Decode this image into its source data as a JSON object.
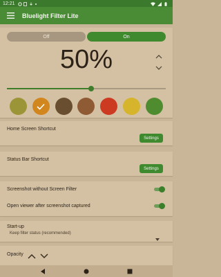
{
  "status_bar": {
    "time": "12:21",
    "left_icons": [
      "gear-icon",
      "battery-saver-icon",
      "download-icon",
      "dot-icon"
    ],
    "right_icons": [
      "wifi-icon",
      "signal-icon",
      "battery-icon"
    ]
  },
  "app_bar": {
    "title": "Bluelight Filter Lite",
    "menu_icon": "hamburger-menu-icon"
  },
  "filter_toggle": {
    "off_label": "Off",
    "on_label": "On",
    "selected": "On"
  },
  "opacity_display": {
    "value_text": "50%",
    "slider_value": 0.53
  },
  "color_swatches": [
    {
      "color": "#9c9538",
      "selected": false
    },
    {
      "color": "#d2861e",
      "selected": true
    },
    {
      "color": "#6a4e30",
      "selected": false
    },
    {
      "color": "#8f5b35",
      "selected": false
    },
    {
      "color": "#cc3a22",
      "selected": false
    },
    {
      "color": "#d6b52c",
      "selected": false
    },
    {
      "color": "#4f8c30",
      "selected": false
    }
  ],
  "home_shortcut": {
    "title": "Home Screen Shortcut",
    "button_label": "Settings"
  },
  "status_shortcut": {
    "title": "Status Bar Shortcut",
    "button_label": "Settings"
  },
  "screenshot_toggles": [
    {
      "label": "Screenshot without Screen Filter",
      "on": true
    },
    {
      "label": "Open viewer after screenshot captured",
      "on": true
    }
  ],
  "startup": {
    "title": "Start-up",
    "selected_option": "Keep filter status (recommended)"
  },
  "opacity_section": {
    "title": "Opacity"
  },
  "colors": {
    "accent": "#3f8a2e",
    "app_bar": "#4a8c35",
    "background": "#c9b597",
    "card": "#d4c0a3"
  }
}
